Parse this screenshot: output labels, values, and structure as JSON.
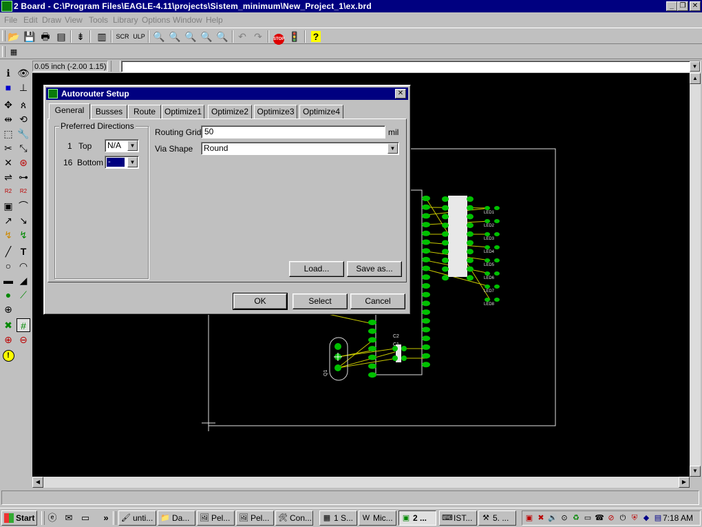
{
  "window": {
    "title": "2 Board - C:\\Program Files\\EAGLE-4.11\\projects\\Sistem_minimum\\New_Project_1\\ex.brd",
    "minimize": "_",
    "maximize": "❐",
    "close": "✕"
  },
  "menu": [
    "File",
    "Edit",
    "Draw",
    "View",
    "Tools",
    "Library",
    "Options",
    "Window",
    "Help"
  ],
  "coord_display": "0.05 inch (-2.00 1.15)",
  "command_input": "",
  "dialog": {
    "title": "Autorouter Setup",
    "close": "✕",
    "tabs": [
      "General",
      "Busses",
      "Route",
      "Optimize1",
      "Optimize2",
      "Optimize3",
      "Optimize4"
    ],
    "selected_tab": "General",
    "preferred_directions": {
      "legend": "Preferred Directions",
      "layers": [
        {
          "number": "1",
          "name": "Top",
          "value": "N/A"
        },
        {
          "number": "16",
          "name": "Bottom",
          "value": "-"
        }
      ]
    },
    "routing_grid": {
      "label": "Routing Grid",
      "value": "50",
      "unit": "mil"
    },
    "via_shape": {
      "label": "Via Shape",
      "value": "Round"
    },
    "buttons": {
      "load": "Load...",
      "save_as": "Save as...",
      "ok": "OK",
      "select": "Select",
      "cancel": "Cancel"
    }
  },
  "board": {
    "labels": {
      "c2": "C2",
      "c1": "C1",
      "q1": "Q1",
      "leds": [
        "LED1",
        "LED2",
        "LED3",
        "LED4",
        "LED5",
        "LED6",
        "LED7",
        "LED8"
      ]
    }
  },
  "taskbar": {
    "start": "Start",
    "more": "»",
    "tasks": [
      {
        "label": "unti...",
        "icon": "paint-icon"
      },
      {
        "label": "Da...",
        "icon": "folder-icon"
      },
      {
        "label": "Pel...",
        "icon": "image-icon"
      },
      {
        "label": "Pel...",
        "icon": "image-icon"
      },
      {
        "label": "Con...",
        "icon": "control-panel-icon"
      },
      {
        "label": "1 S...",
        "icon": "schematic-icon"
      },
      {
        "label": "Mic...",
        "icon": "word-icon"
      },
      {
        "label": "2 ...",
        "icon": "eagle-board-icon",
        "active": true
      },
      {
        "label": "IST...",
        "icon": "install-icon"
      },
      {
        "label": "5. ...",
        "icon": "tools-icon"
      }
    ],
    "clock": "7:18 AM"
  },
  "colors": {
    "titlebar": "#000080",
    "canvas": "#000000",
    "pads": "#00c000",
    "wires": "#c8c800",
    "board_outline": "#e0e0e0"
  }
}
